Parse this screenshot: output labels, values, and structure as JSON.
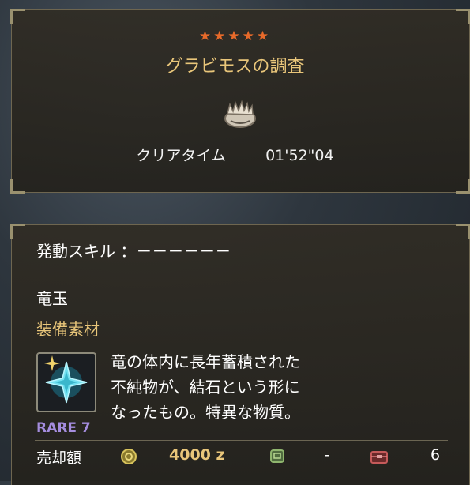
{
  "quest": {
    "stars": "★★★★★",
    "title": "グラビモスの調査",
    "clear_time_label": "クリアタイム",
    "clear_time": "01'52\"04"
  },
  "item": {
    "skill_line": "発動スキル ：－－－－－－",
    "name": "竜玉",
    "category": "装備素材",
    "rarity": "RARE 7",
    "description": [
      "竜の体内に長年蓄積された",
      "不純物が、結石という形に",
      "なったもの。特異な物質。"
    ],
    "sell_label": "売却額",
    "price": "4000 z",
    "pouch_count": "-",
    "box_count": "6"
  },
  "colors": {
    "star": "#e86a2a",
    "gold": "#e9c67a",
    "rare7": "#a58ddf"
  },
  "icons": [
    "monster-icon",
    "dragon-gem-icon",
    "zenny-icon",
    "item-pouch-icon",
    "item-box-icon"
  ]
}
